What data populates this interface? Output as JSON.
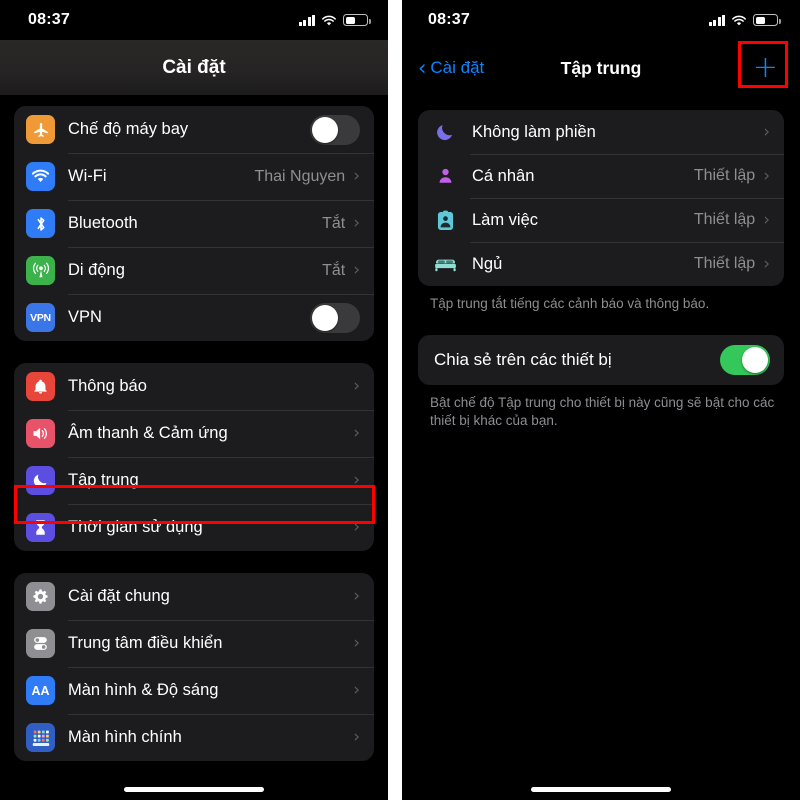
{
  "left_screen": {
    "status": {
      "time": "08:37",
      "battery_level_pct": 42,
      "icons": [
        "cellular-signal-icon",
        "wifi-icon",
        "battery-icon"
      ]
    },
    "nav": {
      "title": "Cài đặt"
    },
    "groups": [
      {
        "id": "connectivity",
        "rows": [
          {
            "label": "Chế độ máy bay",
            "icon": "airplane-icon",
            "icon_color": "#f09a37",
            "control": "toggle",
            "toggle_on": false
          },
          {
            "label": "Wi-Fi",
            "icon": "wifi-icon",
            "icon_color": "#2f7cf6",
            "value": "Thai Nguyen",
            "control": "chevron"
          },
          {
            "label": "Bluetooth",
            "icon": "bluetooth-icon",
            "icon_color": "#2f7cf6",
            "value": "Tắt",
            "control": "chevron"
          },
          {
            "label": "Di động",
            "icon": "cellular-antenna-icon",
            "icon_color": "#3cb24b",
            "value": "Tắt",
            "control": "chevron"
          },
          {
            "label": "VPN",
            "icon": "vpn-icon",
            "icon_color": "#3b76e8",
            "control": "toggle",
            "toggle_on": false
          }
        ]
      },
      {
        "id": "alerts",
        "rows": [
          {
            "label": "Thông báo",
            "icon": "bell-icon",
            "icon_color": "#e8463a",
            "control": "chevron"
          },
          {
            "label": "Âm thanh & Cảm ứng",
            "icon": "speaker-icon",
            "icon_color": "#e8536a",
            "control": "chevron"
          },
          {
            "label": "Tập trung",
            "icon": "moon-icon",
            "icon_color": "#5b4ee0",
            "control": "chevron",
            "highlighted": true
          },
          {
            "label": "Thời gian sử dụng",
            "icon": "hourglass-icon",
            "icon_color": "#5b4ee0",
            "control": "chevron"
          }
        ]
      },
      {
        "id": "general",
        "rows": [
          {
            "label": "Cài đặt chung",
            "icon": "gear-icon",
            "icon_color": "#8e8e93",
            "control": "chevron"
          },
          {
            "label": "Trung tâm điều khiển",
            "icon": "control-center-icon",
            "icon_color": "#8e8e93",
            "control": "chevron"
          },
          {
            "label": "Màn hình & Độ sáng",
            "icon": "aa-display-icon",
            "icon_color": "#2f7cf6",
            "control": "chevron"
          },
          {
            "label": "Màn hình chính",
            "icon": "home-screen-icon",
            "icon_color": "#2f5ec4",
            "control": "chevron"
          }
        ]
      }
    ]
  },
  "right_screen": {
    "status": {
      "time": "08:37",
      "battery_level_pct": 42,
      "icons": [
        "cellular-signal-icon",
        "wifi-icon",
        "battery-icon"
      ]
    },
    "nav": {
      "back_label": "Cài đặt",
      "title": "Tập trung",
      "add_label": "+"
    },
    "focus_modes": [
      {
        "label": "Không làm phiền",
        "icon": "moon-icon",
        "icon_color": "#7a6fe6",
        "value": ""
      },
      {
        "label": "Cá nhân",
        "icon": "person-icon",
        "icon_color": "#c060e6",
        "value": "Thiết lập"
      },
      {
        "label": "Làm việc",
        "icon": "work-badge-icon",
        "icon_color": "#5ec8d8",
        "value": "Thiết lập"
      },
      {
        "label": "Ngủ",
        "icon": "bed-icon",
        "icon_color": "#8fe0d4",
        "value": "Thiết lập"
      }
    ],
    "focus_footnote": "Tập trung tắt tiếng các cảnh báo và thông báo.",
    "share_row": {
      "label": "Chia sẻ trên các thiết bị",
      "toggle_on": true
    },
    "share_footnote": "Bật chế độ Tập trung cho thiết bị này cũng sẽ bật cho các thiết bị khác của bạn."
  },
  "annotations": {
    "accent_red": "#ff0000",
    "boxes": [
      {
        "name": "focus-row-highlight",
        "target": "Tập trung"
      },
      {
        "name": "add-focus-highlight",
        "target": "+"
      }
    ]
  }
}
